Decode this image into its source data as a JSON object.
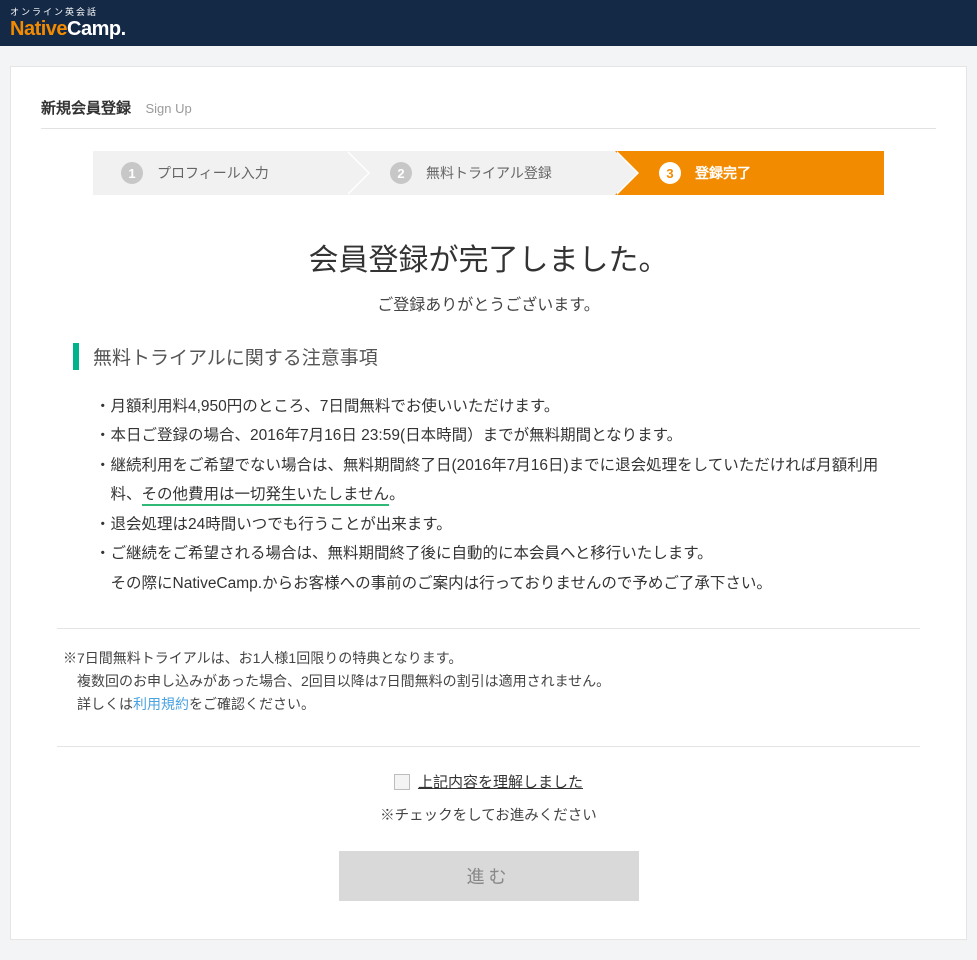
{
  "brand": {
    "tagline": "オンライン英会話",
    "name_part1": "Native",
    "name_part2": "Camp."
  },
  "header": {
    "title_jp": "新規会員登録",
    "title_en": "Sign Up"
  },
  "steps": [
    {
      "num": "1",
      "label": "プロフィール入力"
    },
    {
      "num": "2",
      "label": "無料トライアル登録"
    },
    {
      "num": "3",
      "label": "登録完了"
    }
  ],
  "main": {
    "headline": "会員登録が完了しました。",
    "subline": "ご登録ありがとうございます。"
  },
  "notes": {
    "title": "無料トライアルに関する注意事項",
    "items": [
      "・月額利用料4,950円のところ、7日間無料でお使いいただけます。",
      "・本日ご登録の場合、2016年7月16日 23:59(日本時間）までが無料期間となります。",
      "",
      "・退会処理は24時間いつでも行うことが出来ます。",
      "・ご継続をご希望される場合は、無料期間終了後に自動的に本会員へと移行いたします。\nその際にNativeCamp.からお客様への事前のご案内は行っておりませんので予めご了承下さい。"
    ],
    "item3_pre": "・継続利用をご希望でない場合は、無料期間終了日(2016年7月16日)までに退会処理をしていただければ月額利用料、",
    "item3_underlined": "その他費用は一切発生いたしません",
    "item3_post": "。"
  },
  "disclaimer": {
    "line1": "※7日間無料トライアルは、お1人様1回限りの特典となります。",
    "line2": "複数回のお申し込みがあった場合、2回目以降は7日間無料の割引は適用されません。",
    "line3_pre": "詳しくは",
    "line3_link": "利用規約",
    "line3_post": "をご確認ください。"
  },
  "confirm": {
    "checkbox_label": "上記内容を理解しました",
    "hint": "※チェックをしてお進みください",
    "button": "進む"
  }
}
